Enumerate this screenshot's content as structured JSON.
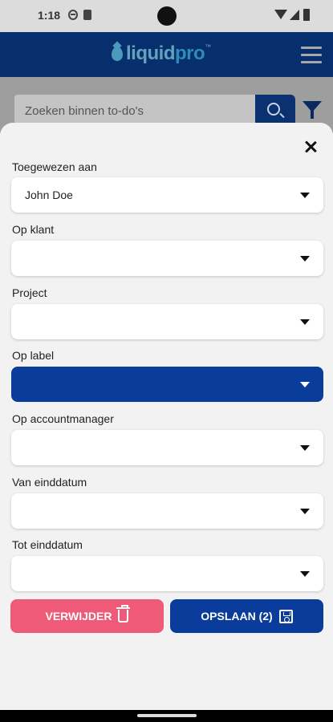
{
  "status_bar": {
    "time": "1:18"
  },
  "header": {
    "logo_part1": "liquid",
    "logo_part2": "pro",
    "logo_tm": "™"
  },
  "search": {
    "placeholder": "Zoeken binnen to-do's"
  },
  "filter_sheet": {
    "fields": [
      {
        "label": "Toegewezen aan",
        "value": "John Doe"
      },
      {
        "label": "Op klant",
        "value": ""
      },
      {
        "label": "Project",
        "value": ""
      },
      {
        "label": "Op label",
        "value": ""
      },
      {
        "label": "Op accountmanager",
        "value": ""
      },
      {
        "label": "Van einddatum",
        "value": ""
      },
      {
        "label": "Tot einddatum",
        "value": ""
      }
    ],
    "delete_label": "VERWIJDER",
    "save_label": "OPSLAAN (2)"
  },
  "colors": {
    "brand_blue": "#0a3c9c",
    "delete_pink": "#ee5a78",
    "logo_light": "#7fd0f2",
    "logo_dark": "#3cb4ee"
  }
}
